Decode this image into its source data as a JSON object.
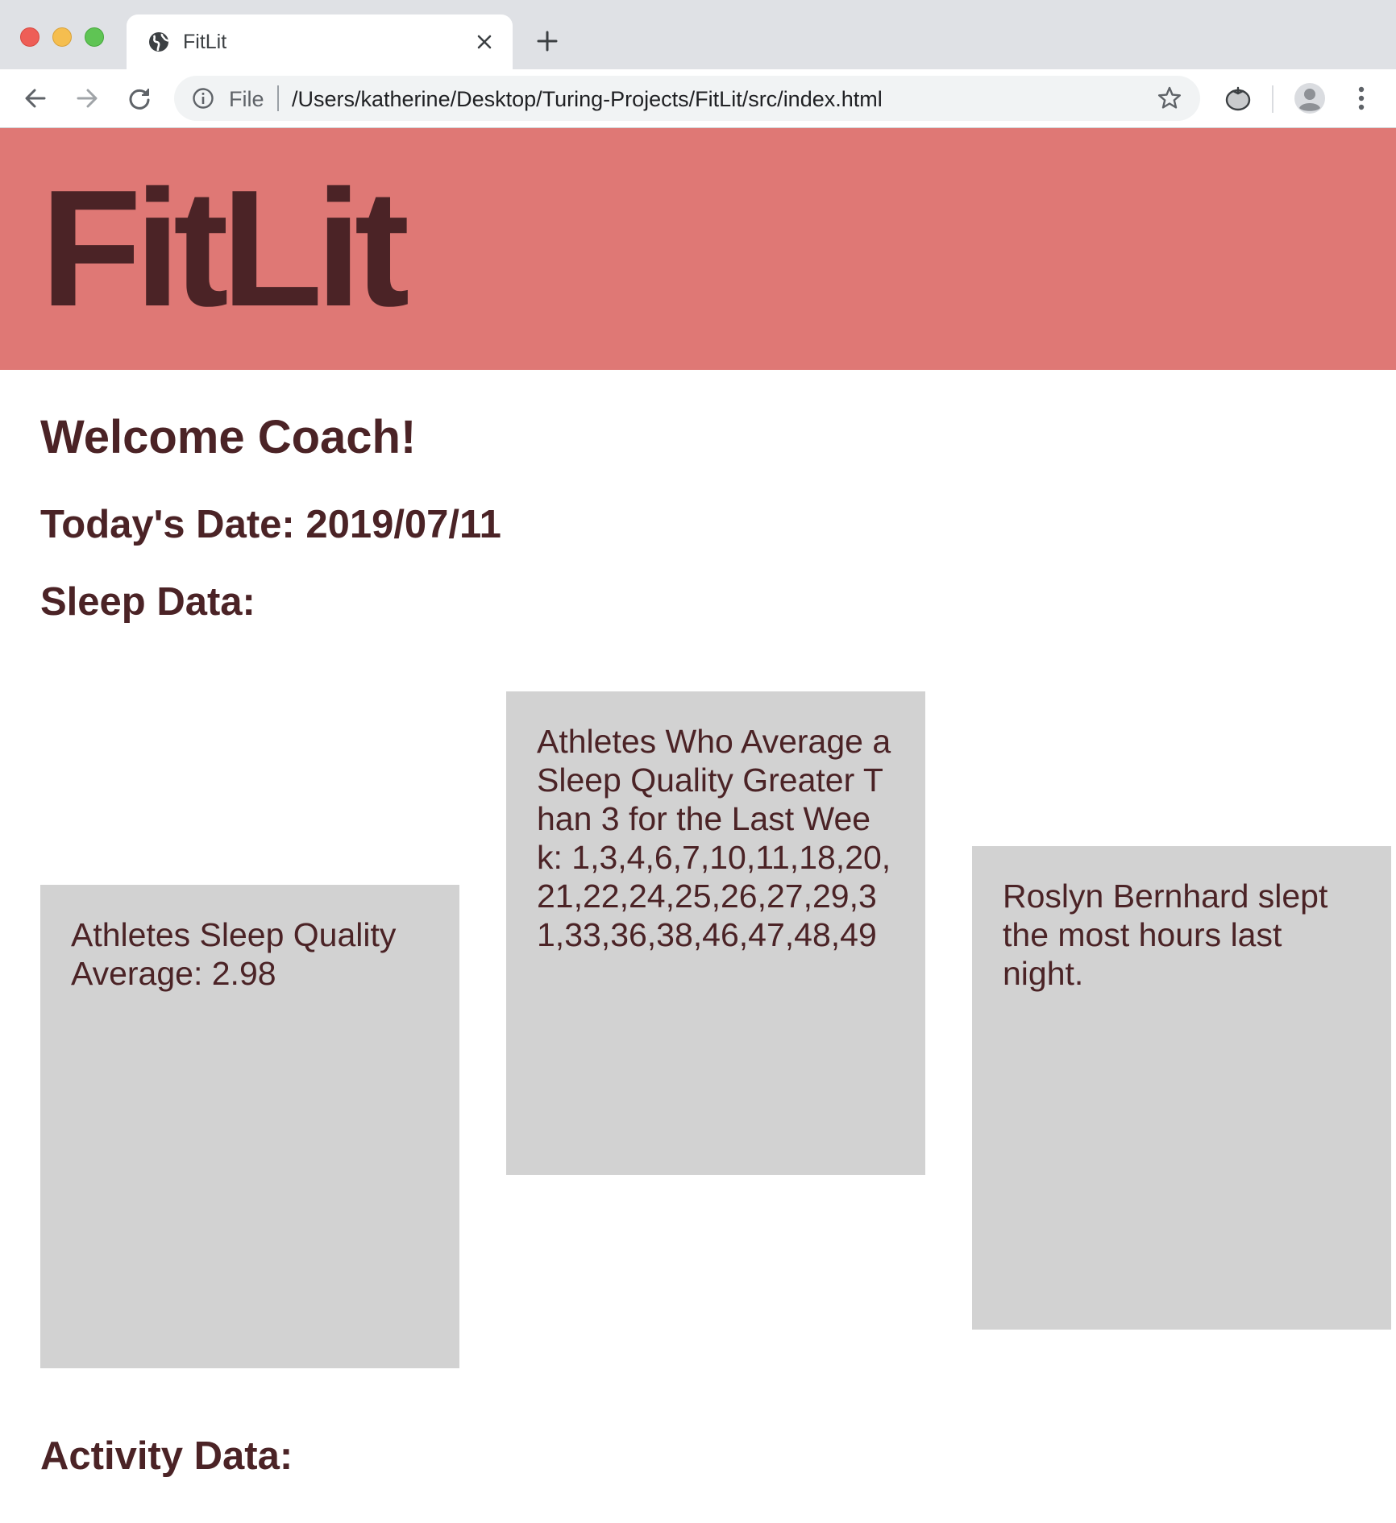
{
  "browser": {
    "tab": {
      "title": "FitLit",
      "favicon": "globe-icon",
      "close": "close-icon"
    },
    "new_tab": "plus-icon",
    "nav": {
      "back": "arrow-left-icon",
      "forward": "arrow-right-icon",
      "reload": "reload-icon"
    },
    "omnibox": {
      "scheme_label": "File",
      "url": "/Users/katherine/Desktop/Turing-Projects/FitLit/src/index.html",
      "info_icon": "info-icon",
      "bookmark_icon": "star-icon"
    },
    "extension_icon": "tomato-extension-icon",
    "profile_icon": "avatar-icon",
    "menu_icon": "kebab-menu-icon"
  },
  "site": {
    "logo": "FitLit",
    "header_color": "#df7875",
    "text_color": "#4b2326",
    "card_color": "#d2d2d2"
  },
  "main": {
    "welcome": "Welcome Coach!",
    "date_line": "Today's Date: 2019/07/11",
    "sleep_heading": "Sleep Data:",
    "activity_heading": "Activity Data:",
    "sleep_cards": [
      {
        "text": "Athletes Sleep Quality Average: 2.98"
      },
      {
        "text": "Athletes Who Average a Sleep Quality Greater Than 3 for the Last Week: 1,3,4,6,7,10,11,18,20,21,22,24,25,26,27,29,31,33,36,38,46,47,48,49"
      },
      {
        "text": "Roslyn Bernhard slept the most hours last night."
      }
    ]
  }
}
